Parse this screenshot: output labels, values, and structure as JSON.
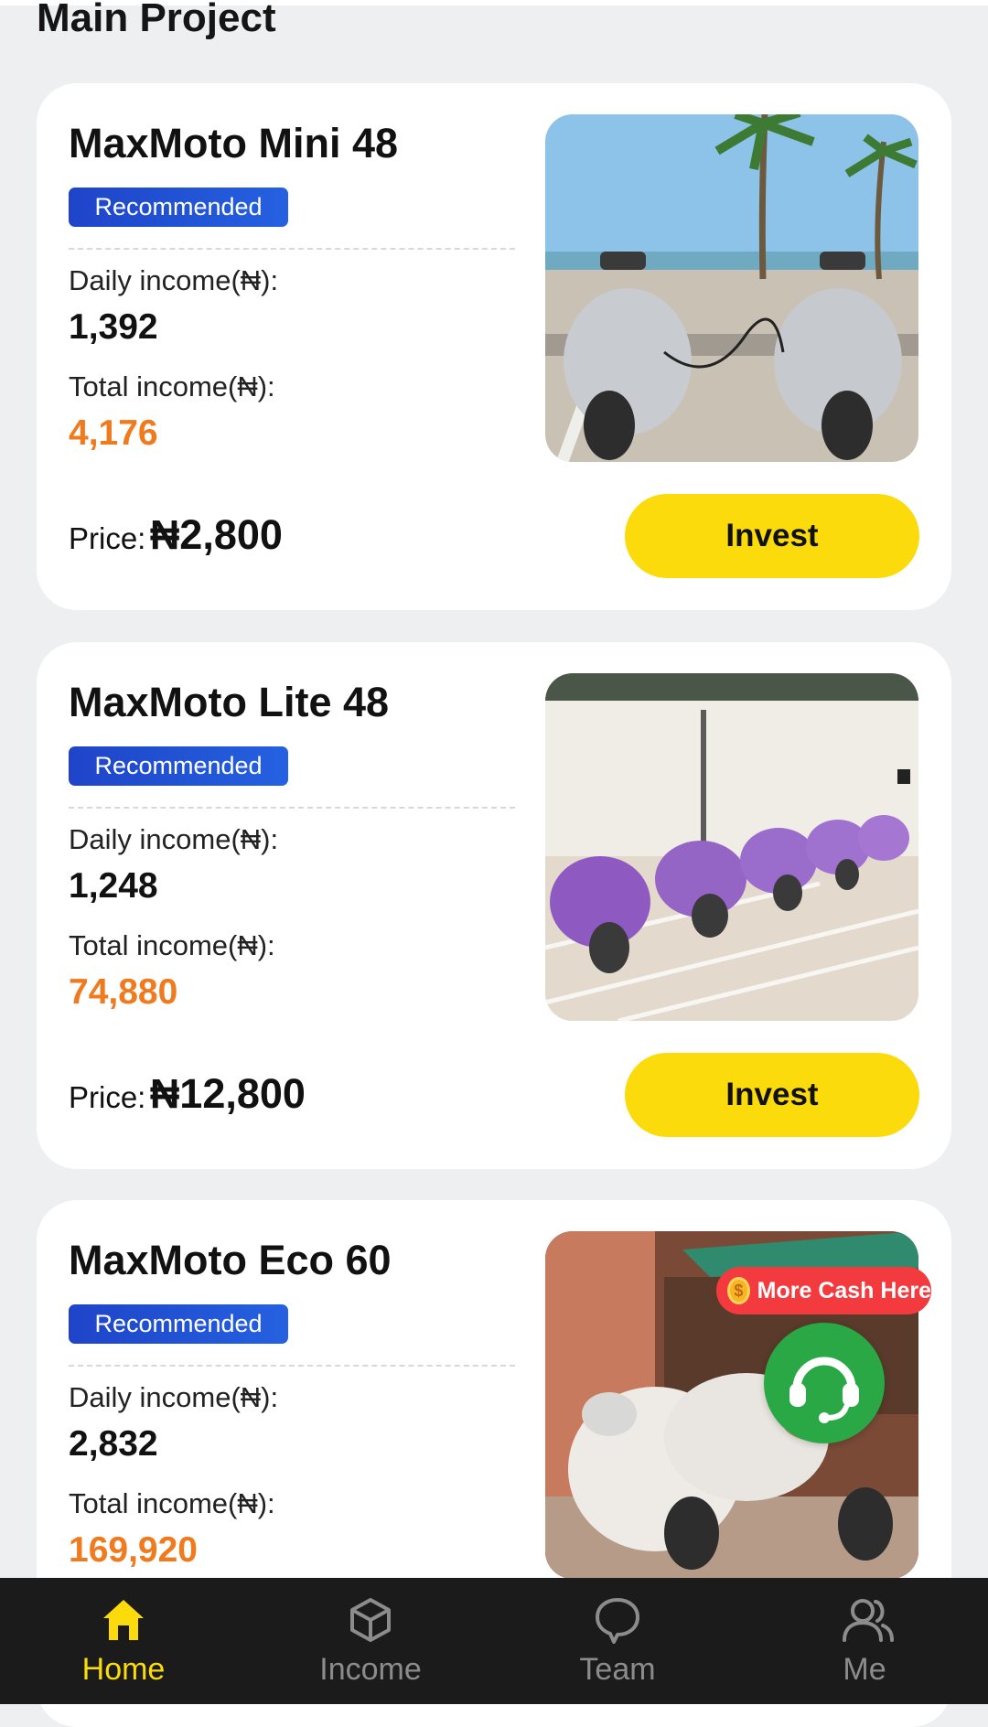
{
  "section_title": "Main Project",
  "products": [
    {
      "name": "MaxMoto Mini 48",
      "badge": "Recommended",
      "daily_label": "Daily income(₦):",
      "daily_value": "1,392",
      "total_label": "Total income(₦):",
      "total_value": "4,176",
      "price_label": "Price:",
      "price_value": "₦2,800",
      "invest_label": "Invest"
    },
    {
      "name": "MaxMoto Lite 48",
      "badge": "Recommended",
      "daily_label": "Daily income(₦):",
      "daily_value": "1,248",
      "total_label": "Total income(₦):",
      "total_value": "74,880",
      "price_label": "Price:",
      "price_value": "₦12,800",
      "invest_label": "Invest"
    },
    {
      "name": "MaxMoto Eco 60",
      "badge": "Recommended",
      "daily_label": "Daily income(₦):",
      "daily_value": "2,832",
      "total_label": "Total income(₦):",
      "total_value": "169,920"
    }
  ],
  "promo": {
    "label": "More Cash Here",
    "icon": "coin-icon"
  },
  "support": {
    "icon": "headset-icon"
  },
  "nav": [
    {
      "label": "Home",
      "icon": "home-icon",
      "active": true
    },
    {
      "label": "Income",
      "icon": "cube-icon",
      "active": false
    },
    {
      "label": "Team",
      "icon": "chat-bubble-icon",
      "active": false
    },
    {
      "label": "Me",
      "icon": "users-icon",
      "active": false
    }
  ],
  "colors": {
    "accent_yellow": "#fbdb0c",
    "badge_blue": "#1f44c9",
    "income_orange": "#f07a1e",
    "promo_red": "#f33a3f",
    "support_green": "#2aa845",
    "nav_background": "#1b1b1b"
  }
}
